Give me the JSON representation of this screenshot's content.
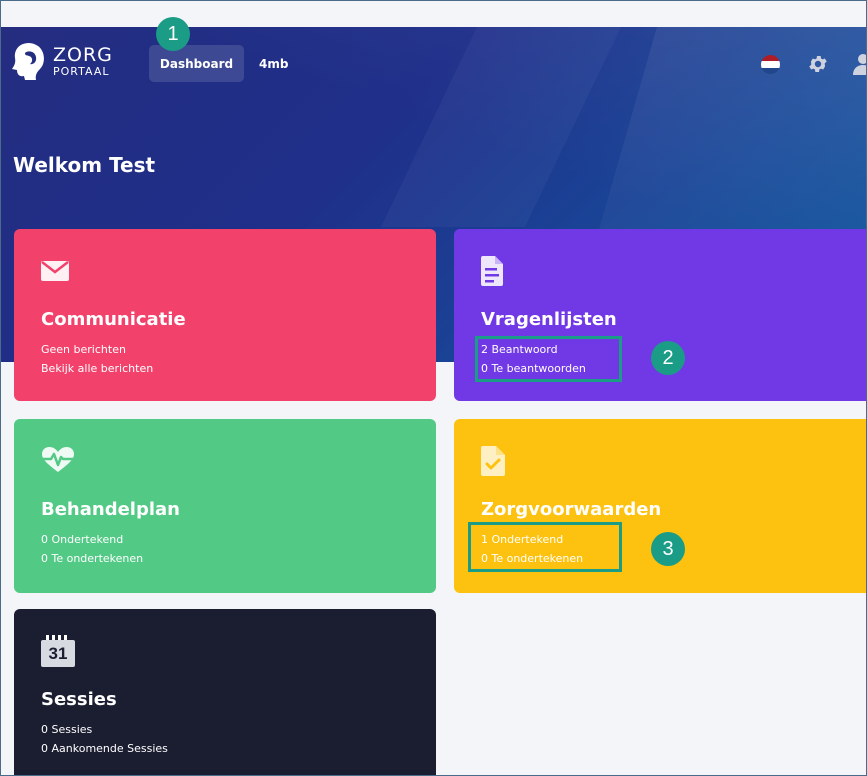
{
  "header": {
    "logo_main": "ZORG",
    "logo_sub": "PORTAAL",
    "nav": [
      {
        "label": "Dashboard",
        "active": true
      },
      {
        "label": "4mb",
        "active": false
      }
    ],
    "icons": [
      "netherlands-flag-icon",
      "gear-icon",
      "user-icon"
    ]
  },
  "welcome": "Welkom Test",
  "cards": [
    {
      "title": "Communicatie",
      "icon": "envelope-icon",
      "lines": [
        "Geen berichten",
        "Bekijk alle berichten"
      ],
      "color": "#f2426c"
    },
    {
      "title": "Vragenlijsten",
      "icon": "document-icon",
      "lines": [
        "2 Beantwoord",
        "0 Te beantwoorden"
      ],
      "color": "#7138e6"
    },
    {
      "title": "Behandelplan",
      "icon": "heartbeat-icon",
      "lines": [
        "0 Ondertekend",
        "0 Te ondertekenen"
      ],
      "color": "#52c985"
    },
    {
      "title": "Zorgvoorwaarden",
      "icon": "document-check-icon",
      "lines": [
        "1 Ondertekend",
        "0 Te ondertekenen"
      ],
      "color": "#fcc20f"
    },
    {
      "title": "Sessies",
      "icon": "calendar-icon",
      "calendar_day": "31",
      "lines": [
        "0 Sessies",
        "0 Aankomende Sessies"
      ],
      "color": "#1b1d31"
    }
  ],
  "annotations": [
    {
      "label": "1",
      "color": "#1a9c87"
    },
    {
      "label": "2",
      "color": "#1a9c87"
    },
    {
      "label": "3",
      "color": "#1a9c87"
    }
  ]
}
